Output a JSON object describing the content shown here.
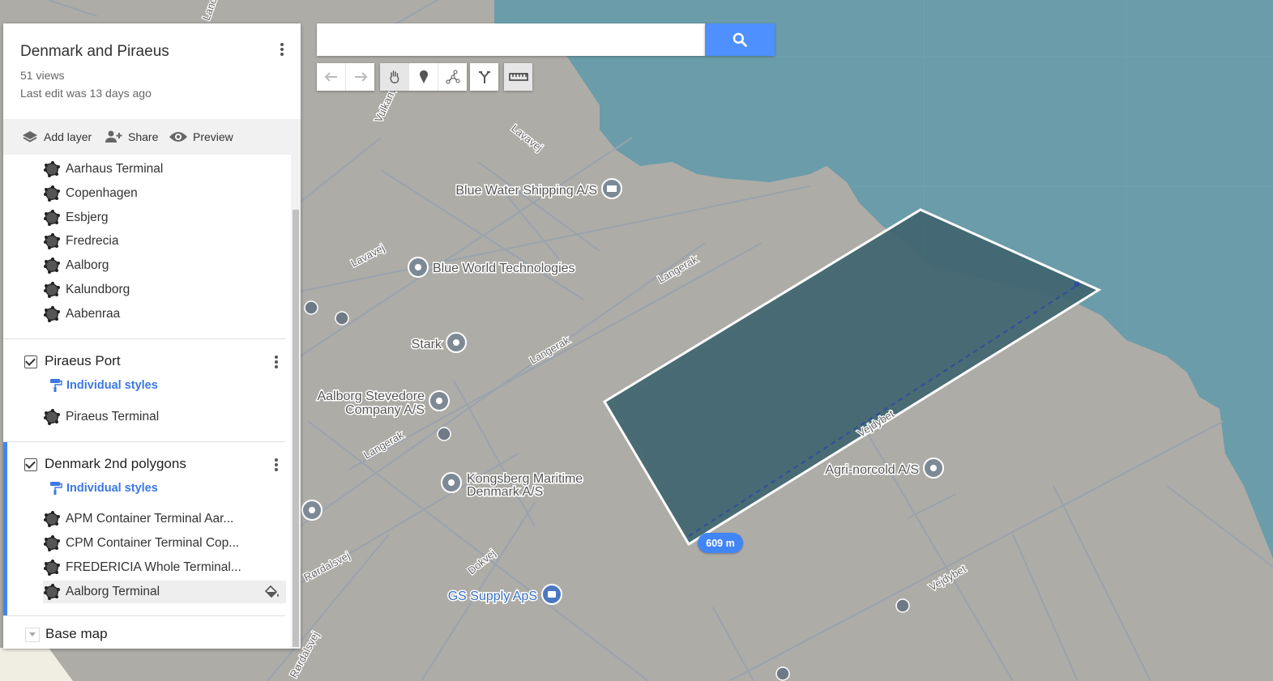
{
  "map_header": {
    "title": "Denmark and Piraeus",
    "views": "51 views",
    "last_edit": "Last edit was 13 days ago"
  },
  "actions": {
    "add_layer": "Add layer",
    "share": "Share",
    "preview": "Preview"
  },
  "layer_denmark": {
    "items": [
      "Aarhaus Terminal",
      "Copenhagen",
      "Esbjerg",
      "Fredrecia",
      "Aalborg",
      "Kalundborg",
      "Aabenraa"
    ]
  },
  "layer_piraeus": {
    "name": "Piraeus Port",
    "styles": "Individual styles",
    "items": [
      "Piraeus Terminal"
    ]
  },
  "layer_polygons": {
    "name": "Denmark 2nd polygons",
    "styles": "Individual styles",
    "items": [
      "APM Container Terminal Aar...",
      "CPM Container Terminal Cop...",
      "FREDERICIA Whole Terminal...",
      "Aalborg Terminal"
    ],
    "selected": "Aalborg Terminal"
  },
  "base_map": "Base map",
  "search": {
    "value": "",
    "placeholder": ""
  },
  "measurement": "609 m",
  "map_places": {
    "blue_water": "Blue Water Shipping A/S",
    "blue_world": "Blue World Technologies",
    "stark": "Stark",
    "stevedore_1": "Aalborg Stevedore",
    "stevedore_2": "Company A/S",
    "kongsberg_1": "Kongsberg Maritime",
    "kongsberg_2": "Denmark A/S",
    "agri": "Agri-norcold A/S",
    "gs": "GS Supply ApS"
  },
  "map_streets": {
    "lavavej": "Lavavej",
    "lavavej2": "Lavavej",
    "langerak1": "Langerak",
    "langerak2": "Langerak",
    "langerak3": "Langerak",
    "vulkanvej": "Vulkanv",
    "dokvej": "Dokvej",
    "rordalsvej": "Rørdalsvej",
    "rordalsvej2": "Rørdalsvej",
    "vejdybet": "Vejdybet",
    "vejdybet2": "Vejdybet",
    "landvej": "Land"
  },
  "colors": {
    "water": "#6b9caa",
    "land": "#aeaca7",
    "polygon_fill": "#3f6570",
    "accent": "#4285f4",
    "link_blue": "#3b78e7"
  }
}
